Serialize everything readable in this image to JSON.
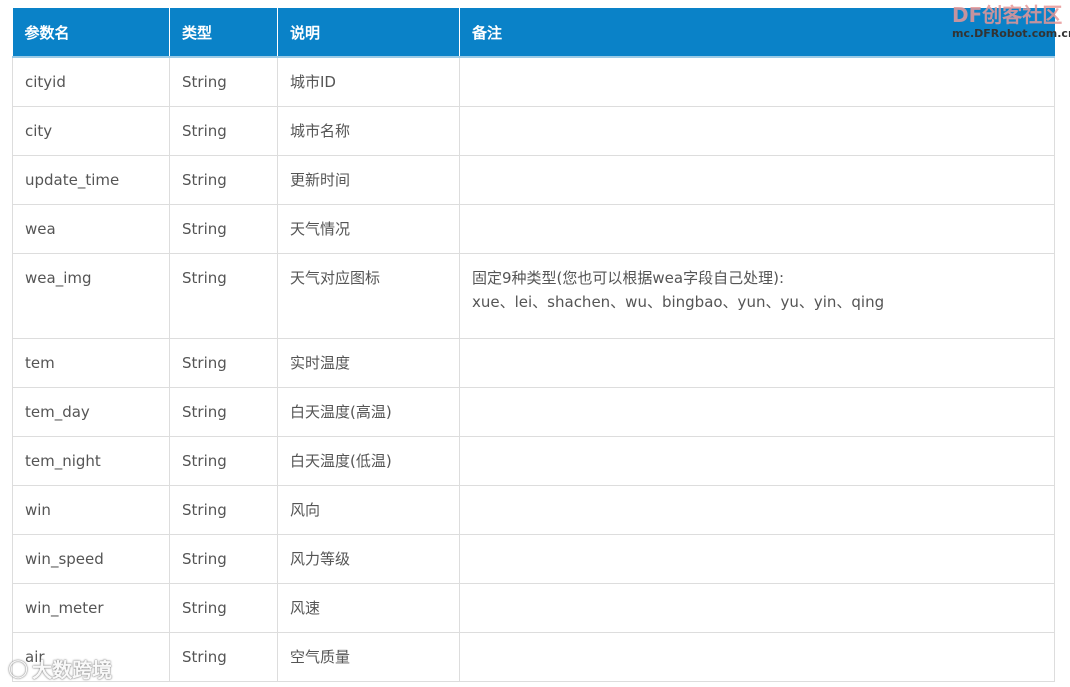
{
  "logo": {
    "main": "DF创客社区",
    "sub": "mc.DFRobot.com.cn"
  },
  "watermark": {
    "text": "大数跨境",
    "icon": "weibo-logo-icon"
  },
  "table": {
    "headers": [
      "参数名",
      "类型",
      "说明",
      "备注"
    ],
    "rows": [
      {
        "name": "cityid",
        "type": "String",
        "desc": "城市ID",
        "note": ""
      },
      {
        "name": "city",
        "type": "String",
        "desc": "城市名称",
        "note": ""
      },
      {
        "name": "update_time",
        "type": "String",
        "desc": "更新时间",
        "note": ""
      },
      {
        "name": "wea",
        "type": "String",
        "desc": "天气情况",
        "note": ""
      },
      {
        "name": "wea_img",
        "type": "String",
        "desc": "天气对应图标",
        "note_line1": "固定9种类型(您也可以根据wea字段自己处理):",
        "note_line2": "xue、lei、shachen、wu、bingbao、yun、yu、yin、qing"
      },
      {
        "name": "tem",
        "type": "String",
        "desc": "实时温度",
        "note": ""
      },
      {
        "name": "tem_day",
        "type": "String",
        "desc": "白天温度(高温)",
        "note": ""
      },
      {
        "name": "tem_night",
        "type": "String",
        "desc": "白天温度(低温)",
        "note": ""
      },
      {
        "name": "win",
        "type": "String",
        "desc": "风向",
        "note": ""
      },
      {
        "name": "win_speed",
        "type": "String",
        "desc": "风力等级",
        "note": ""
      },
      {
        "name": "win_meter",
        "type": "String",
        "desc": "风速",
        "note": ""
      },
      {
        "name": "air",
        "type": "String",
        "desc": "空气质量",
        "note": ""
      }
    ]
  },
  "colors": {
    "header_bg": "#0a82c8",
    "header_text": "#ffffff",
    "cell_text": "#555555",
    "border": "#dddddd"
  }
}
